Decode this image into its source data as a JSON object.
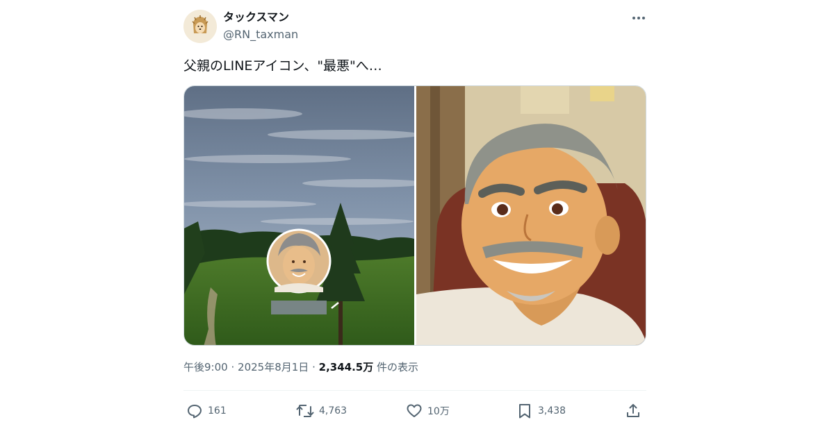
{
  "author": {
    "display_name": "タックスマン",
    "handle": "@RN_taxman",
    "avatar_icon": "hedgehog-avatar-icon"
  },
  "tweet": {
    "text": "父親のLINEアイコン、\"最悪\"へ…"
  },
  "media": {
    "photos": [
      {
        "subject": "golf-course-landscape-with-profile-icon"
      },
      {
        "subject": "anime-style-smiling-man-portrait"
      }
    ]
  },
  "meta": {
    "time": "午後9:00",
    "separator": "·",
    "date": "2025年8月1日",
    "views_count": "2,344.5万",
    "views_label": " 件の表示"
  },
  "actions": {
    "reply": {
      "icon": "reply-icon",
      "count": "161"
    },
    "retweet": {
      "icon": "retweet-icon",
      "count": "4,763"
    },
    "like": {
      "icon": "heart-icon",
      "count": "10万"
    },
    "bookmark": {
      "icon": "bookmark-icon",
      "count": "3,438"
    },
    "share": {
      "icon": "share-icon"
    }
  },
  "colors": {
    "text_primary": "#0f1419",
    "text_secondary": "#536471",
    "divider": "#eff3f4"
  }
}
